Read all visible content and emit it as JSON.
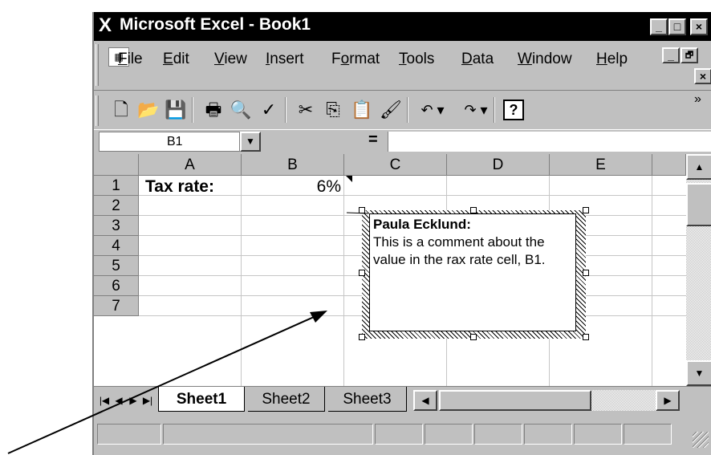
{
  "window": {
    "title": "Microsoft Excel - Book1",
    "app_icon_glyph": "X",
    "caption_buttons": {
      "minimize": "_",
      "maximize": "□",
      "close": "×"
    }
  },
  "menubar": {
    "items": [
      {
        "label": "File",
        "accel": "F",
        "rest": "ile"
      },
      {
        "label": "Edit",
        "accel": "E",
        "rest": "dit"
      },
      {
        "label": "View",
        "accel": "V",
        "rest": "iew"
      },
      {
        "label": "Insert",
        "accel": "I",
        "rest": "nsert"
      },
      {
        "label": "Format",
        "pre": "F",
        "accel": "o",
        "rest": "rmat"
      },
      {
        "label": "Tools",
        "accel": "T",
        "rest": "ools"
      },
      {
        "label": "Data",
        "accel": "D",
        "rest": "ata"
      },
      {
        "label": "Window",
        "accel": "W",
        "rest": "indow"
      },
      {
        "label": "Help",
        "accel": "H",
        "rest": "elp"
      }
    ],
    "doc_buttons": {
      "minimize": "_",
      "restore": "🗗",
      "close": "×"
    }
  },
  "toolbar": {
    "buttons": [
      {
        "name": "new-icon",
        "glyph": "🗋"
      },
      {
        "name": "open-icon",
        "glyph": "📂"
      },
      {
        "name": "save-icon",
        "glyph": "💾"
      },
      {
        "name": "print-icon",
        "glyph": "🖶"
      },
      {
        "name": "print-preview-icon",
        "glyph": "🔍"
      },
      {
        "name": "spelling-icon",
        "glyph": "✓"
      },
      {
        "name": "cut-icon",
        "glyph": "✂"
      },
      {
        "name": "copy-icon",
        "glyph": "⎘"
      },
      {
        "name": "paste-icon",
        "glyph": "📋"
      },
      {
        "name": "format-painter-icon",
        "glyph": "🖌"
      },
      {
        "name": "undo-icon",
        "glyph": "↶ ▾"
      },
      {
        "name": "redo-icon",
        "glyph": "↷ ▾"
      },
      {
        "name": "help-icon",
        "glyph": "?"
      }
    ],
    "overflow_glyph": "»"
  },
  "formula_bar": {
    "name_box": "B1",
    "equals": "=",
    "formula": ""
  },
  "grid": {
    "columns": [
      "A",
      "B",
      "C",
      "D",
      "E"
    ],
    "rows": [
      "1",
      "2",
      "3",
      "4",
      "5",
      "6",
      "7"
    ],
    "cells": {
      "A1": "Tax rate:",
      "B1": "6%"
    }
  },
  "comment": {
    "author": "Paula Ecklund:",
    "text": "This is a comment about the value in the rax rate cell, B1."
  },
  "sheet_tabs": {
    "tabs": [
      "Sheet1",
      "Sheet2",
      "Sheet3"
    ],
    "active": "Sheet1",
    "nav_glyphs": [
      "|◀",
      "◀",
      "▶",
      "▶|"
    ]
  },
  "scrollbar": {
    "up_glyph": "▲",
    "down_glyph": "▼",
    "left_glyph": "◀",
    "right_glyph": "▶"
  },
  "colors": {
    "titlebar": "#000000",
    "chrome": "#c0c0c0",
    "grid_line": "#c6c6c6"
  }
}
